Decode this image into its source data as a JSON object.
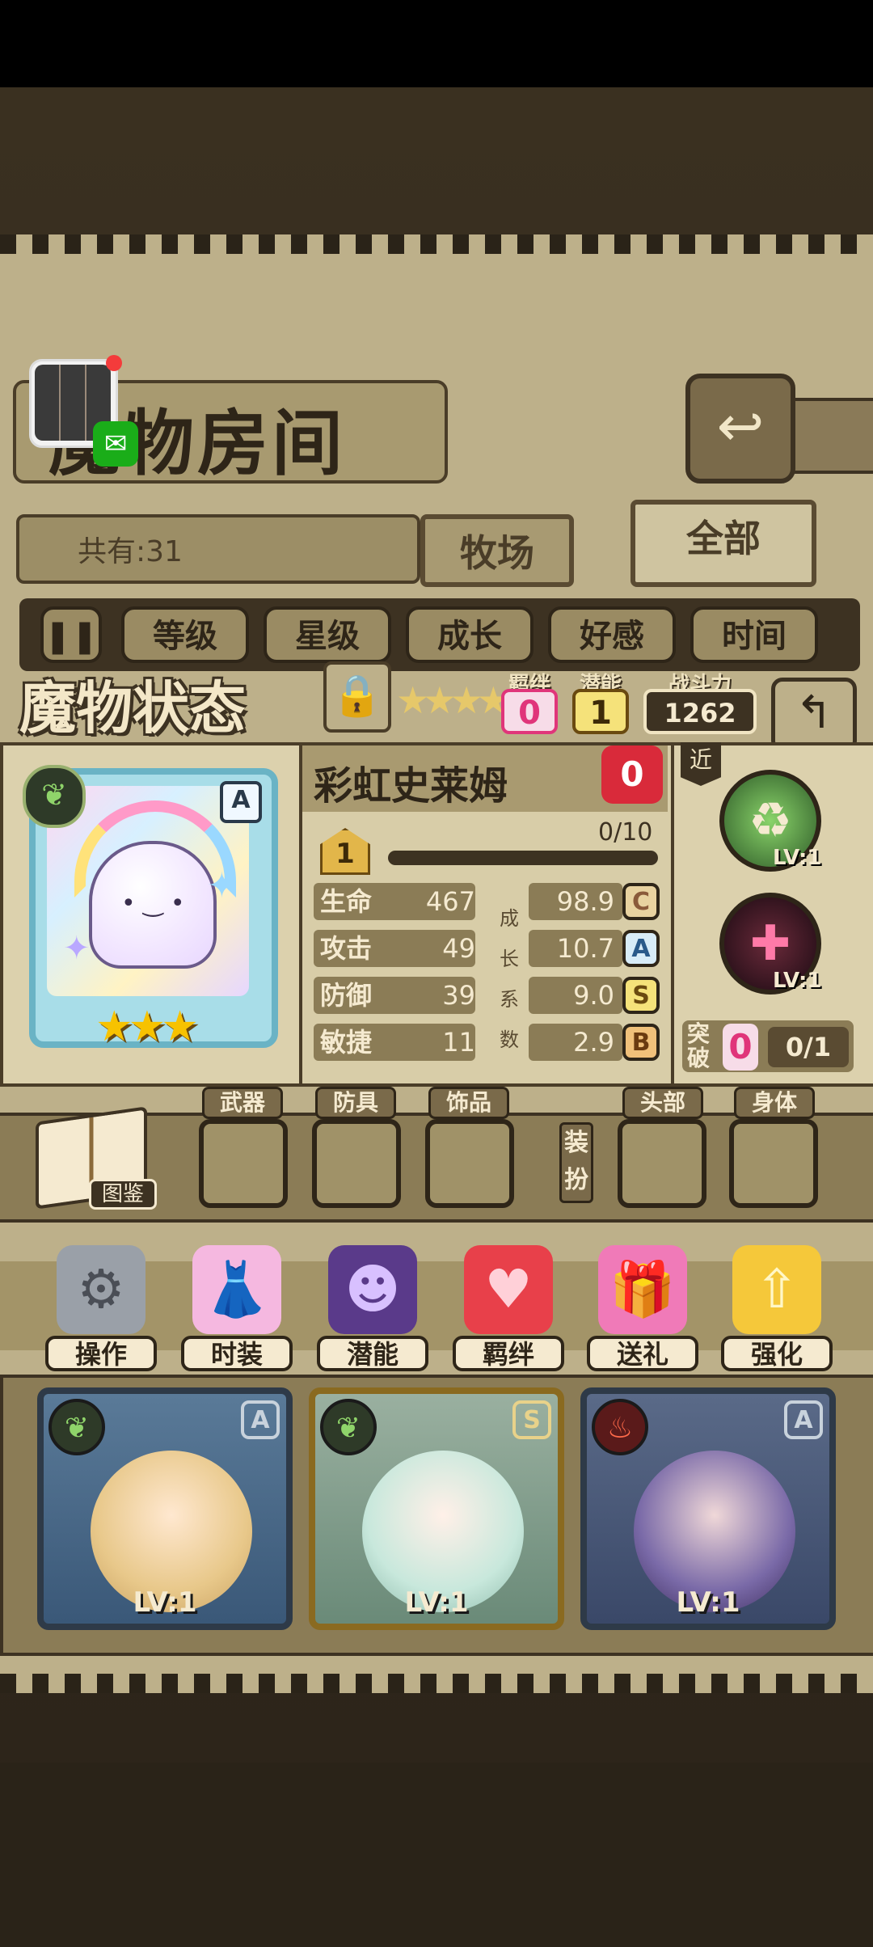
{
  "header": {
    "title": "魔物房间",
    "back_icon": "back-arrow-icon"
  },
  "collection": {
    "count_label": "共有:31"
  },
  "tabs": [
    {
      "label": "牧场"
    },
    {
      "label": "全部"
    }
  ],
  "sort_buttons": [
    "等级",
    "星级",
    "成长",
    "好感",
    "时间"
  ],
  "status": {
    "title": "魔物状态",
    "bond_label": "羁绊",
    "bond_value": "0",
    "potential_label": "潜能",
    "potential_value": "1",
    "power_label": "战斗力",
    "power_value": "1262"
  },
  "monster": {
    "name": "彩虹史莱姆",
    "favor": "0",
    "rank": "A",
    "level": "1",
    "exp": "0/10",
    "exp_fraction": 0,
    "stars": "★★★",
    "range_tag": "近",
    "stats": [
      {
        "label": "生命",
        "value": "467",
        "growth": "98.9",
        "grade": "C"
      },
      {
        "label": "攻击",
        "value": "49",
        "growth": "10.7",
        "grade": "A"
      },
      {
        "label": "防御",
        "value": "39",
        "growth": "9.0",
        "grade": "S"
      },
      {
        "label": "敏捷",
        "value": "11",
        "growth": "2.9",
        "grade": "B"
      }
    ],
    "growth_label_chars": [
      "成",
      "长",
      "系",
      "数"
    ],
    "skills": [
      {
        "level": "LV:1"
      },
      {
        "level": "LV:1"
      }
    ],
    "breakthrough_label": "突破",
    "breakthrough_value": "0",
    "breakthrough_progress": "0/1"
  },
  "equipment": {
    "book_label": "图鉴",
    "slots": [
      "武器",
      "防具",
      "饰品"
    ],
    "dress_label": "装扮",
    "dress_slots": [
      "头部",
      "身体"
    ]
  },
  "actions": [
    "操作",
    "时装",
    "潜能",
    "羁绊",
    "送礼",
    "强化"
  ],
  "monster_cards": [
    {
      "level": "LV:1",
      "rank": "A"
    },
    {
      "level": "LV:1",
      "rank": "S"
    },
    {
      "level": "LV:1",
      "rank": "A"
    }
  ],
  "colors": {
    "accent_pink": "#e0357a",
    "accent_gold": "#e2b64a",
    "panel": "#c9bd96"
  }
}
